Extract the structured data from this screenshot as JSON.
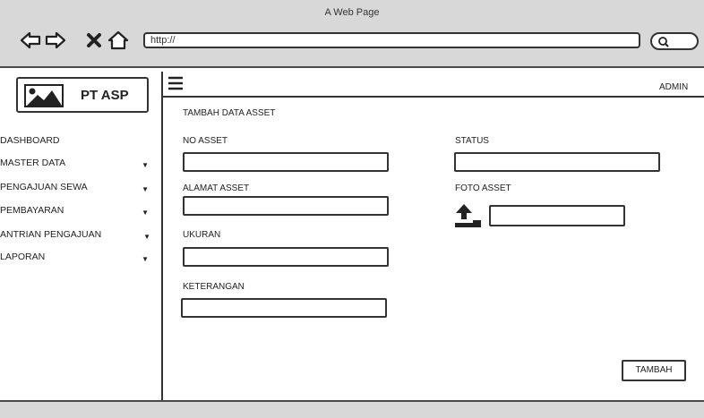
{
  "window": {
    "title": "A Web Page"
  },
  "browser": {
    "url": "http://"
  },
  "sidebar": {
    "brand": "PT ASP",
    "items": [
      {
        "label": "DASHBOARD",
        "has_caret": false
      },
      {
        "label": "MASTER DATA",
        "has_caret": true
      },
      {
        "label": "PENGAJUAN SEWA",
        "has_caret": true
      },
      {
        "label": "PEMBAYARAN",
        "has_caret": true
      },
      {
        "label": "ANTRIAN PENGAJUAN",
        "has_caret": true
      },
      {
        "label": "LAPORAN",
        "has_caret": true
      }
    ]
  },
  "header": {
    "user": "ADMIN"
  },
  "form": {
    "title": "TAMBAH DATA ASSET",
    "no_asset_label": "NO ASSET",
    "alamat_asset_label": "ALAMAT ASSET",
    "ukuran_label": "UKURAN",
    "keterangan_label": "KETERANGAN",
    "status_label": "STATUS",
    "foto_asset_label": "FOTO ASSET",
    "submit_label": "TAMBAH"
  },
  "icons": {
    "back": "back-arrow-icon",
    "forward": "forward-arrow-icon",
    "close": "close-icon",
    "home": "home-icon",
    "search": "search-icon",
    "logo": "image-icon",
    "menu": "hamburger-menu-icon",
    "upload": "upload-icon"
  }
}
